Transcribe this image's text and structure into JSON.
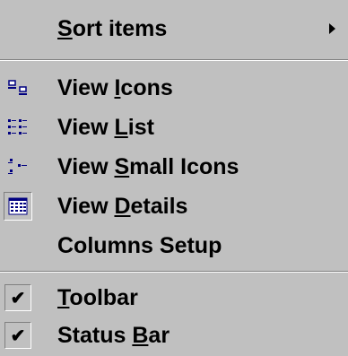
{
  "menu": {
    "sort_items": {
      "pre": "",
      "key": "S",
      "post": "ort items"
    },
    "view_icons": {
      "pre": "View ",
      "key": "I",
      "post": "cons"
    },
    "view_list": {
      "pre": "View ",
      "key": "L",
      "post": "ist"
    },
    "view_small_icons": {
      "pre": "View ",
      "key": "S",
      "post": "mall Icons"
    },
    "view_details": {
      "pre": "View ",
      "key": "D",
      "post": "etails"
    },
    "columns_setup": {
      "pre": "Columns Setup",
      "key": "",
      "post": ""
    },
    "toolbar": {
      "pre": "",
      "key": "T",
      "post": "oolbar",
      "check": "✔"
    },
    "status_bar": {
      "pre": "Status ",
      "key": "B",
      "post": "ar",
      "check": "✔"
    }
  },
  "icons": {
    "submenu": "submenu-arrow-icon",
    "view_icons": "large-icons-view-icon",
    "view_list": "list-view-icon",
    "view_small_icons": "small-icons-view-icon",
    "view_details": "details-view-icon",
    "check": "checkmark-icon"
  },
  "colors": {
    "menu_bg": "#c0c0c0",
    "icon_blue": "#000080"
  }
}
